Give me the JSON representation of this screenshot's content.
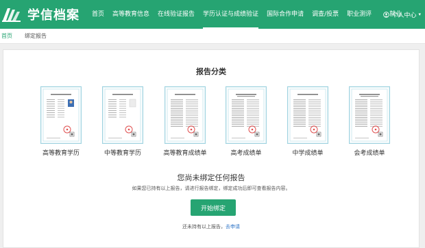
{
  "header": {
    "logo_text": "学信档案",
    "nav": [
      {
        "label": "首页",
        "active": false
      },
      {
        "label": "高等教育信息",
        "active": false
      },
      {
        "label": "在线验证报告",
        "active": false
      },
      {
        "label": "学历认证与成绩验证",
        "active": true
      },
      {
        "label": "国际合作申请",
        "active": false
      },
      {
        "label": "调查/投票",
        "active": false
      },
      {
        "label": "职业测评",
        "active": false
      },
      {
        "label": "就业",
        "active": false
      }
    ],
    "user_center": "个人中心",
    "colors": {
      "brand": "#26a472",
      "link": "#2a72c5"
    }
  },
  "breadcrumb": {
    "home": "首页",
    "current": "绑定报告"
  },
  "main": {
    "section_title": "报告分类",
    "reports": [
      {
        "label": "高等教育学历",
        "icon": "degree-certificate-icon"
      },
      {
        "label": "中等教育学历",
        "icon": "secondary-certificate-icon"
      },
      {
        "label": "高等教育成绩单",
        "icon": "transcript-icon"
      },
      {
        "label": "高考成绩单",
        "icon": "gaokao-transcript-icon"
      },
      {
        "label": "中学成绩单",
        "icon": "middle-school-transcript-icon"
      },
      {
        "label": "会考成绩单",
        "icon": "huikao-transcript-icon"
      }
    ],
    "empty_title": "您尚未绑定任何报告",
    "empty_desc": "如果您已持有以上报告，请进行报告绑定，绑定成功后即可查看报告内容。",
    "bind_button": "开始绑定",
    "apply_prefix": "还未持有以上报告，",
    "apply_link": "去申请"
  }
}
